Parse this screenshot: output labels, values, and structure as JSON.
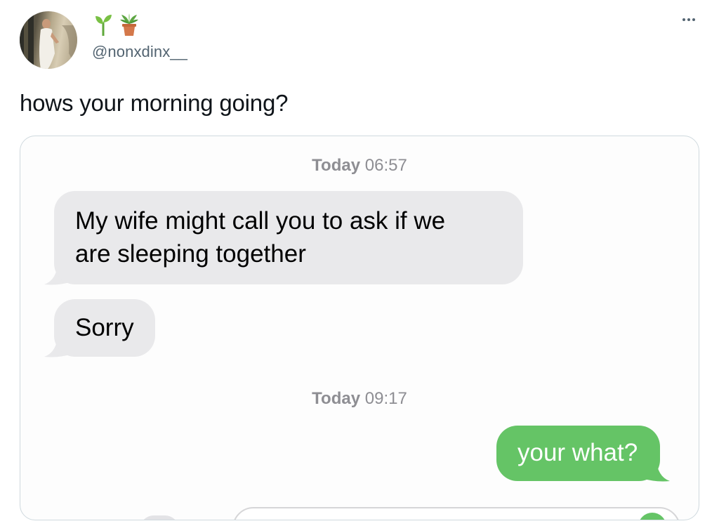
{
  "tweet": {
    "handle": "@nonxdinx__",
    "emojis": [
      "seedling-icon",
      "potted-plant-icon"
    ],
    "text": "hows your morning going?"
  },
  "imessage": {
    "timestamps": [
      {
        "day": "Today",
        "time": "06:57"
      },
      {
        "day": "Today",
        "time": "09:17"
      }
    ],
    "messages": [
      {
        "side": "incoming",
        "line1": "My wife might call you to ask if we",
        "line2": "are sleeping together"
      },
      {
        "side": "incoming",
        "text": "Sorry"
      },
      {
        "side": "outgoing",
        "text": "your what?"
      }
    ]
  },
  "colors": {
    "incoming_bubble": "#e9e9eb",
    "outgoing_bubble": "#65c466",
    "handle_text": "#536471",
    "timestamp_text": "#8e8e93"
  }
}
